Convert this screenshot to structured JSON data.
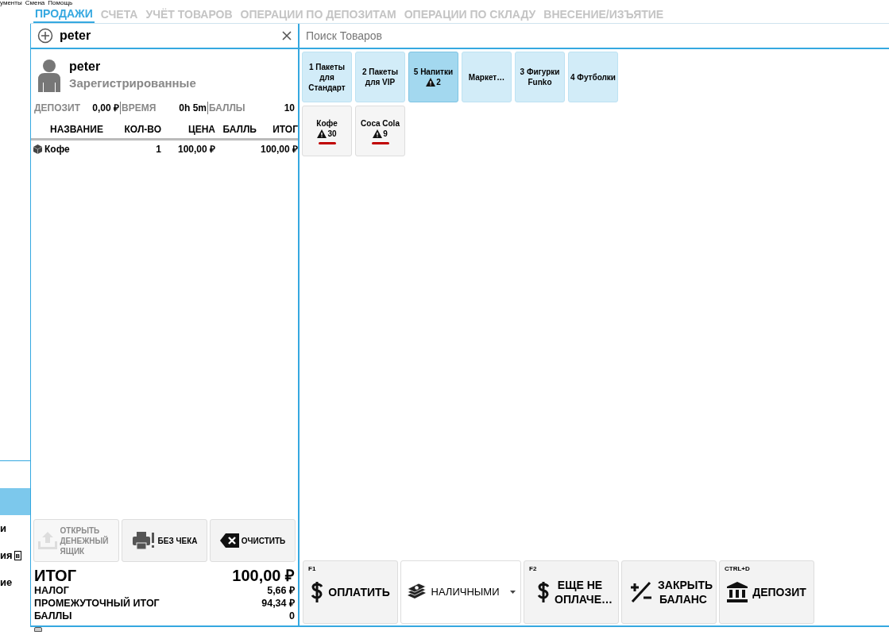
{
  "menu": [
    "ументы",
    "Смена",
    "Помощь"
  ],
  "tabs": [
    {
      "label": "ПРОДАЖИ",
      "selected": true
    },
    {
      "label": "СЧЕТА",
      "selected": false
    },
    {
      "label": "УЧЁТ ТОВАРОВ",
      "selected": false
    },
    {
      "label": "ОПЕРАЦИИ ПО ДЕПОЗИТАМ",
      "selected": false
    },
    {
      "label": "ОПЕРАЦИИ ПО СКЛАДУ",
      "selected": false
    },
    {
      "label": "ВНЕСЕНИЕ/ИЗЪЯТИЕ",
      "selected": false
    }
  ],
  "side_strip": {
    "items": [
      {
        "selected": true
      },
      {
        "label": "и",
        "selected": false
      },
      {
        "label": "ия",
        "badge": "в",
        "selected": false
      },
      {
        "label": "ие",
        "selected": false
      }
    ]
  },
  "customer_search": {
    "value": "peter"
  },
  "customer": {
    "name": "peter",
    "group": "Зарегистрированные"
  },
  "stats": [
    {
      "label": "ДЕПОЗИТ",
      "value": "0,00 ₽"
    },
    {
      "label": "ВРЕМЯ",
      "value": "0h 5m"
    },
    {
      "label": "БАЛЛЫ",
      "value": "10"
    }
  ],
  "order_table": {
    "columns": [
      "НАЗВАНИЕ",
      "КОЛ-ВО",
      "ЦЕНА",
      "БАЛЛЬ",
      "ИТОГ"
    ],
    "rows": [
      {
        "cells": [
          "Кофе",
          "1",
          "100,00 ₽",
          "",
          "100,00 ₽"
        ]
      }
    ]
  },
  "actions": [
    {
      "kind": "drawer",
      "label": "ОТКРЫТЬ ДЕНЕЖНЫЙ ЯЩИК",
      "disabled": true
    },
    {
      "kind": "printer",
      "label": "БЕЗ ЧЕКА",
      "disabled": false
    },
    {
      "kind": "clear",
      "label": "ОЧИСТИТЬ",
      "disabled": false
    }
  ],
  "totals": {
    "total_label": "ИТОГ",
    "total": "100,00 ₽",
    "lines": [
      {
        "label": "НАЛОГ",
        "value": "5,66 ₽"
      },
      {
        "label": "ПРОМЕЖУТОЧНЫЙ ИТОГ",
        "value": "94,34 ₽"
      },
      {
        "label": "БАЛЛЫ",
        "value": "0"
      }
    ]
  },
  "product_search": {
    "placeholder": "Поиск Товаров"
  },
  "categories": [
    {
      "label": "1 Пакеты для Стандарт",
      "selected": false
    },
    {
      "label": "2 Пакеты для VIP",
      "selected": false
    },
    {
      "label": "5 Напитки",
      "warning": "2",
      "selected": true
    },
    {
      "label": "Маркет…",
      "selected": false
    },
    {
      "label": "3 Фигурки Funko",
      "selected": false
    },
    {
      "label": "4 Футболки",
      "selected": false
    }
  ],
  "products": [
    {
      "name": "Кофе",
      "warning": "30",
      "low_stock": true
    },
    {
      "name": "Coca Cola",
      "warning": "9",
      "low_stock": true
    }
  ],
  "payment_buttons": [
    {
      "kind": "pay",
      "hotkey": "F1",
      "label": "ОПЛАТИТЬ"
    },
    {
      "kind": "method",
      "label": "НАЛИЧНЫМИ"
    },
    {
      "kind": "unpaid",
      "hotkey": "F2",
      "label": "ЕЩЕ НЕ ОПЛАЧЕ…"
    },
    {
      "kind": "balance",
      "label": "ЗАКРЫТЬ БАЛАНС"
    },
    {
      "kind": "deposit",
      "hotkey": "CTRL+D",
      "label": "ДЕПОЗИТ"
    }
  ]
}
